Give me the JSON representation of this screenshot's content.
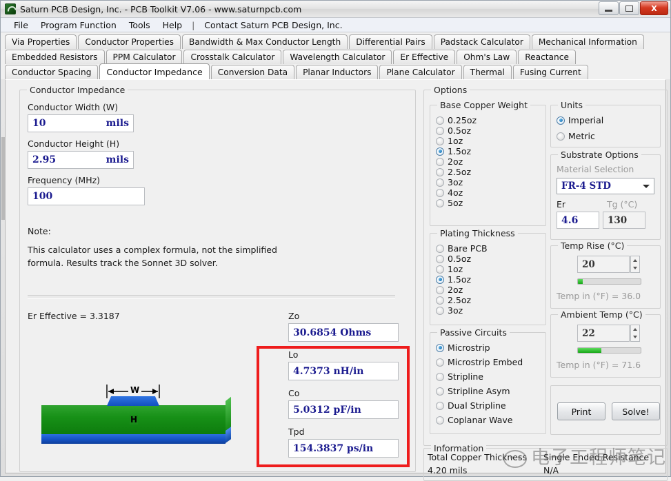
{
  "window": {
    "title": "Saturn PCB Design, Inc. - PCB Toolkit V7.06 - www.saturnpcb.com",
    "minimize": "–",
    "maximize": "□",
    "close": "X"
  },
  "menu": {
    "items": [
      "File",
      "Program Function",
      "Tools",
      "Help"
    ],
    "separator": "|",
    "contact": "Contact Saturn PCB Design, Inc."
  },
  "tabs": {
    "row1": [
      "Via Properties",
      "Conductor Properties",
      "Bandwidth & Max Conductor Length",
      "Differential Pairs",
      "Padstack Calculator",
      "Mechanical Information"
    ],
    "row2": [
      "Embedded Resistors",
      "PPM Calculator",
      "Crosstalk Calculator",
      "Wavelength Calculator",
      "Er Effective",
      "Ohm's Law",
      "Reactance"
    ],
    "row3": [
      "Conductor Spacing",
      "Conductor Impedance",
      "Conversion Data",
      "Planar Inductors",
      "Plane Calculator",
      "Thermal",
      "Fusing Current"
    ],
    "active": "Conductor Impedance"
  },
  "left_panel": {
    "group_label": "Conductor Impedance",
    "width_label": "Conductor Width (W)",
    "width_value": "10",
    "width_unit": "mils",
    "height_label": "Conductor Height (H)",
    "height_value": "2.95",
    "height_unit": "mils",
    "frequency_label": "Frequency (MHz)",
    "frequency_value": "100",
    "note_title": "Note:",
    "note_line1": "This calculator uses a complex formula, not the simplified",
    "note_line2": "formula. Results track the Sonnet 3D solver.",
    "er_effective": "Er Effective = 3.3187",
    "diagram": {
      "w_label": "W",
      "h_label": "H"
    }
  },
  "results": {
    "zo_label": "Zo",
    "zo_value": "30.6854 Ohms",
    "lo_label": "Lo",
    "lo_value": "4.7373 nH/in",
    "co_label": "Co",
    "co_value": "5.0312 pF/in",
    "tpd_label": "Tpd",
    "tpd_value": "154.3837 ps/in",
    "highlight_color": "#ee1c1c"
  },
  "options": {
    "group_label": "Options",
    "base_copper": {
      "label": "Base Copper Weight",
      "items": [
        "0.25oz",
        "0.5oz",
        "1oz",
        "1.5oz",
        "2oz",
        "2.5oz",
        "3oz",
        "4oz",
        "5oz"
      ],
      "selected": "1.5oz"
    },
    "plating": {
      "label": "Plating Thickness",
      "items": [
        "Bare PCB",
        "0.5oz",
        "1oz",
        "1.5oz",
        "2oz",
        "2.5oz",
        "3oz"
      ],
      "selected": "1.5oz"
    },
    "passive": {
      "label": "Passive Circuits",
      "items": [
        "Microstrip",
        "Microstrip Embed",
        "Stripline",
        "Stripline Asym",
        "Dual Stripline",
        "Coplanar Wave"
      ],
      "selected": "Microstrip"
    },
    "units": {
      "label": "Units",
      "items": [
        "Imperial",
        "Metric"
      ],
      "selected": "Imperial"
    },
    "substrate": {
      "label": "Substrate Options",
      "material_label": "Material Selection",
      "material_value": "FR-4 STD",
      "er_label": "Er",
      "er_value": "4.6",
      "tg_label": "Tg (°C)",
      "tg_value": "130"
    },
    "temp_rise": {
      "label": "Temp Rise (°C)",
      "value": "20",
      "progress_pct": 8,
      "readout": "Temp in (°F) = 36.0"
    },
    "ambient_temp": {
      "label": "Ambient Temp (°C)",
      "value": "22",
      "progress_pct": 37,
      "readout": "Temp in (°F) = 71.6"
    },
    "buttons": {
      "print": "Print",
      "solve": "Solve!"
    }
  },
  "information": {
    "label": "Information",
    "copper_thickness_label": "Total Copper Thickness",
    "copper_thickness_value": "4.20 mils",
    "resistance_label": "Single Ended Resistance",
    "resistance_value": "N/A"
  },
  "watermark": {
    "text": "电子工程师笔记"
  }
}
